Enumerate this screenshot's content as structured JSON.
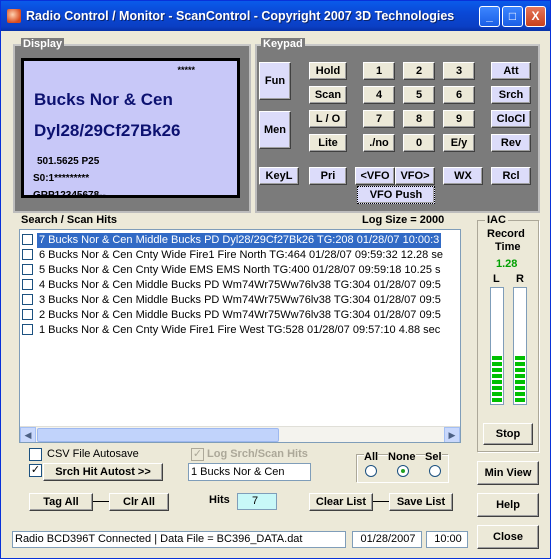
{
  "window": {
    "title": "Radio Control / Monitor - ScanControl - Copyright 2007 3D Technologies",
    "min": "_",
    "max": "□",
    "close": "X"
  },
  "display": {
    "label": "Display",
    "stars": "*****",
    "line1": "Bucks Nor & Cen",
    "line2": "Dyl28/29Cf27Bk26",
    "line3": "501.5625 P25",
    "line4": "S0:1*********",
    "line5": "GRP12345678--"
  },
  "keypad": {
    "label": "Keypad",
    "fun": "Fun",
    "men": "Men",
    "hold": "Hold",
    "scan": "Scan",
    "lo": "L / O",
    "lite": "Lite",
    "digits": [
      "1",
      "2",
      "3",
      "4",
      "5",
      "6",
      "7",
      "8",
      "9",
      "./no",
      "0",
      "E/y"
    ],
    "att": "Att",
    "srch": "Srch",
    "clocl": "CloCl",
    "rev": "Rev",
    "keyl": "KeyL",
    "pri": "Pri",
    "vfo_down": "<VFO",
    "vfo_up": "VFO>",
    "vfo_push": "VFO Push",
    "wx": "WX",
    "rcl": "Rcl"
  },
  "search": {
    "label": "Search / Scan Hits",
    "log_size": "Log Size = 2000",
    "rows": [
      "7  Bucks Nor & Cen  Middle Bucks PD   Dyl28/29Cf27Bk26   TG:208  01/28/07  10:00:3",
      "6  Bucks Nor & Cen  Cnty Wide Fire1   Fire North   TG:464  01/28/07   09:59:32  12.28 se",
      "5  Bucks Nor & Cen  Cnty Wide EMS   EMS North   TG:400  01/28/07   09:59:18  10.25 s",
      "4  Bucks Nor & Cen  Middle Bucks PD   Wm74Wr75Ww76lv38   TG:304  01/28/07  09:5",
      "3  Bucks Nor & Cen  Middle Bucks PD   Wm74Wr75Ww76lv38   TG:304  01/28/07  09:5",
      "2  Bucks Nor & Cen  Middle Bucks PD   Wm74Wr75Ww76lv38   TG:304  01/28/07  09:5",
      "1  Bucks Nor & Cen  Cnty Wide Fire1   Fire West   TG:528  01/28/07   09:57:10  4.88 sec"
    ],
    "selected_index": 0
  },
  "controls": {
    "csv_autosave": "CSV File Autosave",
    "log_srch": "Log Srch/Scan Hits",
    "srch_hit_autost": "Srch Hit Autost >>",
    "srch_checked": "✓",
    "dropdown_value": "1 Bucks Nor & Cen",
    "all": "All",
    "none": "None",
    "sel": "Sel",
    "tag_all": "Tag All",
    "clr_all": "Clr All",
    "hits_label": "Hits",
    "hits_value": "7",
    "clear_list": "Clear List",
    "save_list": "Save List"
  },
  "iac": {
    "label": "IAC",
    "record_time_label": "Record Time",
    "record_time_value": "1.28",
    "l": "L",
    "r": "R",
    "stop": "Stop",
    "level_left_segments": 8,
    "level_right_segments": 8
  },
  "side_buttons": {
    "min_view": "Min View",
    "help": "Help",
    "close": "Close"
  },
  "status": {
    "connection": "Radio BCD396T Connected | Data File = BC396_DATA.dat",
    "date": "01/28/2007",
    "time": "10:00"
  },
  "colors": {
    "title_blue": "#0a48d6",
    "panel_gray": "#7b7b7b",
    "lcd_bg": "#c8c8f8",
    "lcd_text": "#0c1170",
    "lavender_button": "#dcdcfa",
    "selection": "#316ac5",
    "meter_green": "#00c000",
    "record_time_green": "#00a000"
  }
}
